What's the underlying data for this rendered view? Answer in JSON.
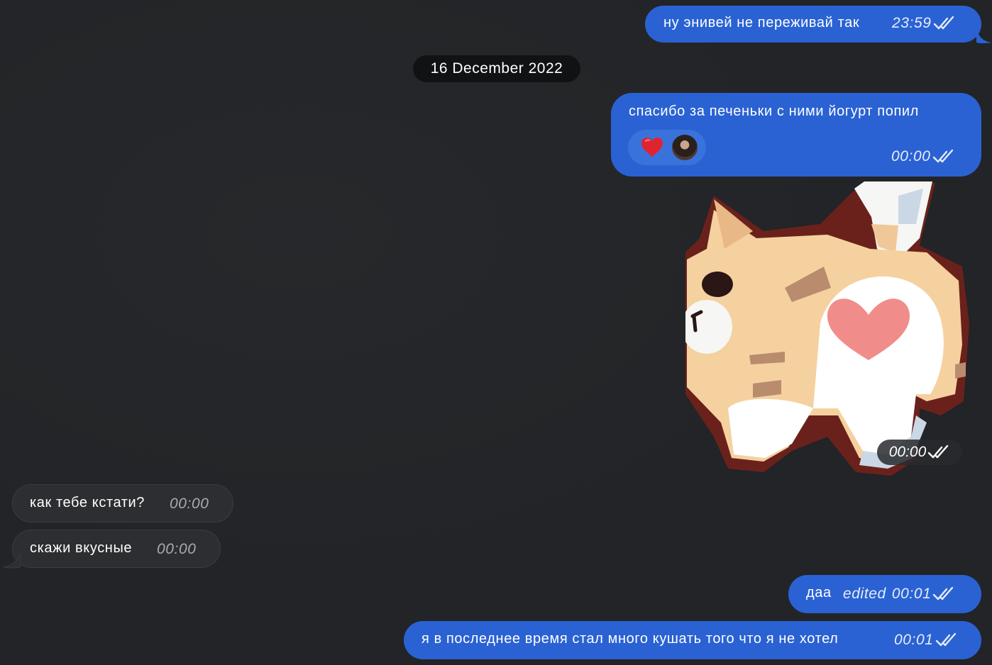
{
  "date_separator": "16 December 2022",
  "messages": [
    {
      "text": "ну энивей не переживай так",
      "time": "23:59"
    },
    {
      "text": "спасибо за печеньки с ними йогурт попил",
      "time": "00:00",
      "reaction": "heart-icon"
    },
    {
      "sticker": "cat-heart-sticker",
      "time": "00:00"
    },
    {
      "text": "как тебе кстати?",
      "time": "00:00"
    },
    {
      "text": "скажи вкусные",
      "time": "00:00"
    },
    {
      "text": "даа",
      "edited_label": "edited",
      "time": "00:01"
    },
    {
      "text": "я в последнее время стал много кушать того что я не хотел",
      "time": "00:01"
    }
  ],
  "colors": {
    "outgoing_bubble": "#2a62d3",
    "incoming_bubble": "#2c2e31",
    "background": "#222427"
  }
}
